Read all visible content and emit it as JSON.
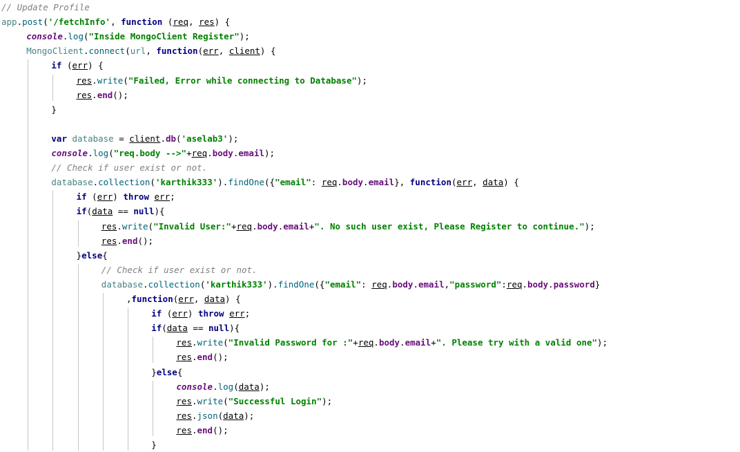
{
  "colors": {
    "keyword": "#000080",
    "string": "#008000",
    "comment": "#808080",
    "italic_member": "#660e7a",
    "function_call": "#00627a",
    "global": "#458383",
    "indent_guide": "#c6c6c6"
  },
  "code": {
    "lines": [
      {
        "indent": 0,
        "tokens": [
          {
            "t": "cm",
            "v": "// Update Profile"
          }
        ]
      },
      {
        "indent": 0,
        "tokens": [
          {
            "t": "global",
            "v": "app"
          },
          {
            "t": "punc",
            "v": "."
          },
          {
            "t": "fn",
            "v": "post"
          },
          {
            "t": "punc",
            "v": "("
          },
          {
            "t": "str",
            "v": "'/fetchInfo'"
          },
          {
            "t": "punc",
            "v": ", "
          },
          {
            "t": "kw",
            "v": "function"
          },
          {
            "t": "punc",
            "v": " ("
          },
          {
            "t": "param",
            "v": "req"
          },
          {
            "t": "punc",
            "v": ", "
          },
          {
            "t": "param",
            "v": "res"
          },
          {
            "t": "punc",
            "v": ") {"
          }
        ]
      },
      {
        "indent": 1,
        "tokens": [
          {
            "t": "it",
            "v": "console"
          },
          {
            "t": "punc",
            "v": "."
          },
          {
            "t": "fn",
            "v": "log"
          },
          {
            "t": "punc",
            "v": "("
          },
          {
            "t": "str",
            "v": "\"Inside MongoClient Register\""
          },
          {
            "t": "punc",
            "v": ");"
          }
        ]
      },
      {
        "indent": 1,
        "tokens": [
          {
            "t": "global",
            "v": "MongoClient"
          },
          {
            "t": "punc",
            "v": "."
          },
          {
            "t": "fn",
            "v": "connect"
          },
          {
            "t": "punc",
            "v": "("
          },
          {
            "t": "global",
            "v": "url"
          },
          {
            "t": "punc",
            "v": ", "
          },
          {
            "t": "kw",
            "v": "function"
          },
          {
            "t": "punc",
            "v": "("
          },
          {
            "t": "param",
            "v": "err"
          },
          {
            "t": "punc",
            "v": ", "
          },
          {
            "t": "param",
            "v": "client"
          },
          {
            "t": "punc",
            "v": ") {"
          }
        ]
      },
      {
        "indent": 2,
        "tokens": [
          {
            "t": "kw",
            "v": "if"
          },
          {
            "t": "punc",
            "v": " ("
          },
          {
            "t": "param",
            "v": "err"
          },
          {
            "t": "punc",
            "v": ") {"
          }
        ]
      },
      {
        "indent": 3,
        "tokens": [
          {
            "t": "param",
            "v": "res"
          },
          {
            "t": "punc",
            "v": "."
          },
          {
            "t": "fn",
            "v": "write"
          },
          {
            "t": "punc",
            "v": "("
          },
          {
            "t": "str",
            "v": "\"Failed, Error while connecting to Database\""
          },
          {
            "t": "punc",
            "v": ");"
          }
        ]
      },
      {
        "indent": 3,
        "tokens": [
          {
            "t": "param",
            "v": "res"
          },
          {
            "t": "punc",
            "v": "."
          },
          {
            "t": "mem",
            "v": "end"
          },
          {
            "t": "punc",
            "v": "();"
          }
        ]
      },
      {
        "indent": 2,
        "tokens": [
          {
            "t": "punc",
            "v": "}"
          }
        ]
      },
      {
        "indent": 2,
        "tokens": []
      },
      {
        "indent": 2,
        "tokens": [
          {
            "t": "kw",
            "v": "var"
          },
          {
            "t": "plain",
            "v": " "
          },
          {
            "t": "global",
            "v": "database"
          },
          {
            "t": "punc",
            "v": " = "
          },
          {
            "t": "param",
            "v": "client"
          },
          {
            "t": "punc",
            "v": "."
          },
          {
            "t": "mem",
            "v": "db"
          },
          {
            "t": "punc",
            "v": "("
          },
          {
            "t": "str",
            "v": "'aselab3'"
          },
          {
            "t": "punc",
            "v": ");"
          }
        ]
      },
      {
        "indent": 2,
        "tokens": [
          {
            "t": "it",
            "v": "console"
          },
          {
            "t": "punc",
            "v": "."
          },
          {
            "t": "fn",
            "v": "log"
          },
          {
            "t": "punc",
            "v": "("
          },
          {
            "t": "str",
            "v": "\"req.body -->\""
          },
          {
            "t": "punc",
            "v": "+"
          },
          {
            "t": "param",
            "v": "req"
          },
          {
            "t": "punc",
            "v": "."
          },
          {
            "t": "mem",
            "v": "body"
          },
          {
            "t": "punc",
            "v": "."
          },
          {
            "t": "mem",
            "v": "email"
          },
          {
            "t": "punc",
            "v": ");"
          }
        ]
      },
      {
        "indent": 2,
        "tokens": [
          {
            "t": "cm",
            "v": "// Check if user exist or not."
          }
        ]
      },
      {
        "indent": 2,
        "tokens": [
          {
            "t": "global",
            "v": "database"
          },
          {
            "t": "punc",
            "v": "."
          },
          {
            "t": "fn",
            "v": "collection"
          },
          {
            "t": "punc",
            "v": "("
          },
          {
            "t": "str",
            "v": "'karthik333'"
          },
          {
            "t": "punc",
            "v": ")."
          },
          {
            "t": "fn",
            "v": "findOne"
          },
          {
            "t": "punc",
            "v": "({"
          },
          {
            "t": "str",
            "v": "\"email\""
          },
          {
            "t": "punc",
            "v": ": "
          },
          {
            "t": "param",
            "v": "req"
          },
          {
            "t": "punc",
            "v": "."
          },
          {
            "t": "mem",
            "v": "body"
          },
          {
            "t": "punc",
            "v": "."
          },
          {
            "t": "mem",
            "v": "email"
          },
          {
            "t": "punc",
            "v": "}, "
          },
          {
            "t": "kw",
            "v": "function"
          },
          {
            "t": "punc",
            "v": "("
          },
          {
            "t": "param",
            "v": "err"
          },
          {
            "t": "punc",
            "v": ", "
          },
          {
            "t": "param",
            "v": "data"
          },
          {
            "t": "punc",
            "v": ") {"
          }
        ]
      },
      {
        "indent": 3,
        "tokens": [
          {
            "t": "kw",
            "v": "if"
          },
          {
            "t": "punc",
            "v": " ("
          },
          {
            "t": "param",
            "v": "err"
          },
          {
            "t": "punc",
            "v": ") "
          },
          {
            "t": "kw",
            "v": "throw"
          },
          {
            "t": "plain",
            "v": " "
          },
          {
            "t": "param",
            "v": "err"
          },
          {
            "t": "punc",
            "v": ";"
          }
        ]
      },
      {
        "indent": 3,
        "tokens": [
          {
            "t": "kw",
            "v": "if"
          },
          {
            "t": "punc",
            "v": "("
          },
          {
            "t": "param",
            "v": "data"
          },
          {
            "t": "punc",
            "v": " == "
          },
          {
            "t": "kw",
            "v": "null"
          },
          {
            "t": "punc",
            "v": "){"
          }
        ]
      },
      {
        "indent": 4,
        "tokens": [
          {
            "t": "param",
            "v": "res"
          },
          {
            "t": "punc",
            "v": "."
          },
          {
            "t": "fn",
            "v": "write"
          },
          {
            "t": "punc",
            "v": "("
          },
          {
            "t": "str",
            "v": "\"Invalid User:\""
          },
          {
            "t": "punc",
            "v": "+"
          },
          {
            "t": "param",
            "v": "req"
          },
          {
            "t": "punc",
            "v": "."
          },
          {
            "t": "mem",
            "v": "body"
          },
          {
            "t": "punc",
            "v": "."
          },
          {
            "t": "mem",
            "v": "email"
          },
          {
            "t": "punc",
            "v": "+"
          },
          {
            "t": "str",
            "v": "\". No such user exist, Please Register to continue.\""
          },
          {
            "t": "punc",
            "v": ");"
          }
        ]
      },
      {
        "indent": 4,
        "tokens": [
          {
            "t": "param",
            "v": "res"
          },
          {
            "t": "punc",
            "v": "."
          },
          {
            "t": "mem",
            "v": "end"
          },
          {
            "t": "punc",
            "v": "();"
          }
        ]
      },
      {
        "indent": 3,
        "tokens": [
          {
            "t": "punc",
            "v": "}"
          },
          {
            "t": "kw",
            "v": "else"
          },
          {
            "t": "punc",
            "v": "{"
          }
        ]
      },
      {
        "indent": 4,
        "tokens": [
          {
            "t": "cm",
            "v": "// Check if user exist or not."
          }
        ]
      },
      {
        "indent": 4,
        "tokens": [
          {
            "t": "global",
            "v": "database"
          },
          {
            "t": "punc",
            "v": "."
          },
          {
            "t": "fn",
            "v": "collection"
          },
          {
            "t": "punc",
            "v": "("
          },
          {
            "t": "str",
            "v": "'karthik333'"
          },
          {
            "t": "punc",
            "v": ")."
          },
          {
            "t": "fn",
            "v": "findOne"
          },
          {
            "t": "punc",
            "v": "({"
          },
          {
            "t": "str",
            "v": "\"email\""
          },
          {
            "t": "punc",
            "v": ": "
          },
          {
            "t": "param",
            "v": "req"
          },
          {
            "t": "punc",
            "v": "."
          },
          {
            "t": "mem",
            "v": "body"
          },
          {
            "t": "punc",
            "v": "."
          },
          {
            "t": "mem",
            "v": "email"
          },
          {
            "t": "punc",
            "v": ","
          },
          {
            "t": "str",
            "v": "\"password\""
          },
          {
            "t": "punc",
            "v": ":"
          },
          {
            "t": "param",
            "v": "req"
          },
          {
            "t": "punc",
            "v": "."
          },
          {
            "t": "mem",
            "v": "body"
          },
          {
            "t": "punc",
            "v": "."
          },
          {
            "t": "mem",
            "v": "password"
          },
          {
            "t": "punc",
            "v": "}"
          }
        ]
      },
      {
        "indent": 5,
        "tokens": [
          {
            "t": "punc",
            "v": ","
          },
          {
            "t": "kw",
            "v": "function"
          },
          {
            "t": "punc",
            "v": "("
          },
          {
            "t": "param",
            "v": "err"
          },
          {
            "t": "punc",
            "v": ", "
          },
          {
            "t": "param",
            "v": "data"
          },
          {
            "t": "punc",
            "v": ") {"
          }
        ]
      },
      {
        "indent": 6,
        "tokens": [
          {
            "t": "kw",
            "v": "if"
          },
          {
            "t": "punc",
            "v": " ("
          },
          {
            "t": "param",
            "v": "err"
          },
          {
            "t": "punc",
            "v": ") "
          },
          {
            "t": "kw",
            "v": "throw"
          },
          {
            "t": "plain",
            "v": " "
          },
          {
            "t": "param",
            "v": "err"
          },
          {
            "t": "punc",
            "v": ";"
          }
        ]
      },
      {
        "indent": 6,
        "tokens": [
          {
            "t": "kw",
            "v": "if"
          },
          {
            "t": "punc",
            "v": "("
          },
          {
            "t": "param",
            "v": "data"
          },
          {
            "t": "punc",
            "v": " == "
          },
          {
            "t": "kw",
            "v": "null"
          },
          {
            "t": "punc",
            "v": "){"
          }
        ]
      },
      {
        "indent": 7,
        "tokens": [
          {
            "t": "param",
            "v": "res"
          },
          {
            "t": "punc",
            "v": "."
          },
          {
            "t": "fn",
            "v": "write"
          },
          {
            "t": "punc",
            "v": "("
          },
          {
            "t": "str",
            "v": "\"Invalid Password for :\""
          },
          {
            "t": "punc",
            "v": "+"
          },
          {
            "t": "param",
            "v": "req"
          },
          {
            "t": "punc",
            "v": "."
          },
          {
            "t": "mem",
            "v": "body"
          },
          {
            "t": "punc",
            "v": "."
          },
          {
            "t": "mem",
            "v": "email"
          },
          {
            "t": "punc",
            "v": "+"
          },
          {
            "t": "str",
            "v": "\". Please try with a valid one\""
          },
          {
            "t": "punc",
            "v": ");"
          }
        ]
      },
      {
        "indent": 7,
        "tokens": [
          {
            "t": "param",
            "v": "res"
          },
          {
            "t": "punc",
            "v": "."
          },
          {
            "t": "mem",
            "v": "end"
          },
          {
            "t": "punc",
            "v": "();"
          }
        ]
      },
      {
        "indent": 6,
        "tokens": [
          {
            "t": "punc",
            "v": "}"
          },
          {
            "t": "kw",
            "v": "else"
          },
          {
            "t": "punc",
            "v": "{"
          }
        ]
      },
      {
        "indent": 7,
        "tokens": [
          {
            "t": "it",
            "v": "console"
          },
          {
            "t": "punc",
            "v": "."
          },
          {
            "t": "fn",
            "v": "log"
          },
          {
            "t": "punc",
            "v": "("
          },
          {
            "t": "param",
            "v": "data"
          },
          {
            "t": "punc",
            "v": ");"
          }
        ]
      },
      {
        "indent": 7,
        "tokens": [
          {
            "t": "param",
            "v": "res"
          },
          {
            "t": "punc",
            "v": "."
          },
          {
            "t": "fn",
            "v": "write"
          },
          {
            "t": "punc",
            "v": "("
          },
          {
            "t": "str",
            "v": "\"Successful Login\""
          },
          {
            "t": "punc",
            "v": ");"
          }
        ]
      },
      {
        "indent": 7,
        "tokens": [
          {
            "t": "param",
            "v": "res"
          },
          {
            "t": "punc",
            "v": "."
          },
          {
            "t": "fn",
            "v": "json"
          },
          {
            "t": "punc",
            "v": "("
          },
          {
            "t": "param",
            "v": "data"
          },
          {
            "t": "punc",
            "v": ");"
          }
        ]
      },
      {
        "indent": 7,
        "tokens": [
          {
            "t": "param",
            "v": "res"
          },
          {
            "t": "punc",
            "v": "."
          },
          {
            "t": "mem",
            "v": "end"
          },
          {
            "t": "punc",
            "v": "();"
          }
        ]
      },
      {
        "indent": 6,
        "tokens": [
          {
            "t": "punc",
            "v": "}"
          }
        ]
      }
    ]
  }
}
